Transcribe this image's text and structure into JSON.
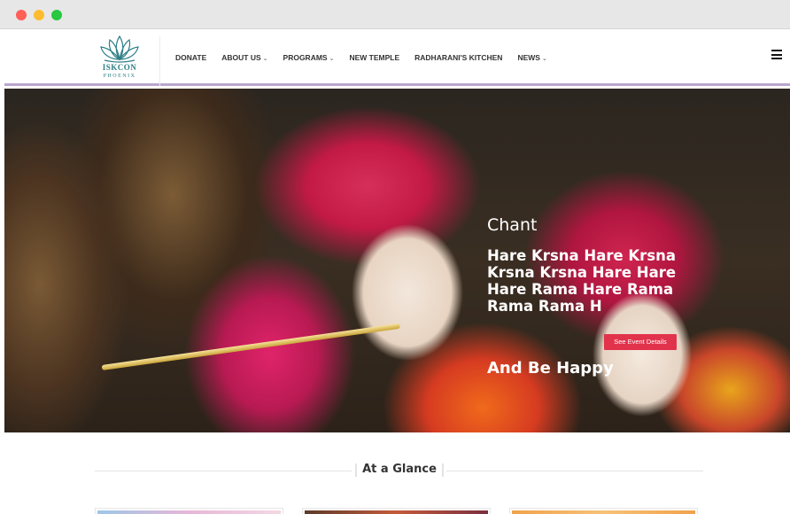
{
  "chrome": {
    "buttons": [
      "close",
      "minimize",
      "maximize"
    ]
  },
  "logo": {
    "brand": "ISKCON",
    "city": "PHOENIX",
    "icon": "lotus-icon",
    "color": "#2f7f86"
  },
  "nav": {
    "items": [
      {
        "label": "DONATE",
        "dropdown": false
      },
      {
        "label": "ABOUT US",
        "dropdown": true
      },
      {
        "label": "PROGRAMS",
        "dropdown": true
      },
      {
        "label": "NEW TEMPLE",
        "dropdown": false
      },
      {
        "label": "RADHARANI'S KITCHEN",
        "dropdown": false
      },
      {
        "label": "NEWS",
        "dropdown": true
      }
    ],
    "caret": "⌄",
    "menu_icon": "hamburger-icon"
  },
  "hero": {
    "subtitle": "Chant",
    "title": "Hare Krsna Hare Krsna Krsna Krsna Hare Hare Hare Rama Hare Rama Rama Rama H",
    "tagline": "And Be Happy",
    "button_label": "See Event Details",
    "accent": "#e2334c"
  },
  "glance": {
    "title": "At a Glance"
  },
  "colors": {
    "header_border": "#b9a6cf",
    "nav_text": "#333333"
  }
}
